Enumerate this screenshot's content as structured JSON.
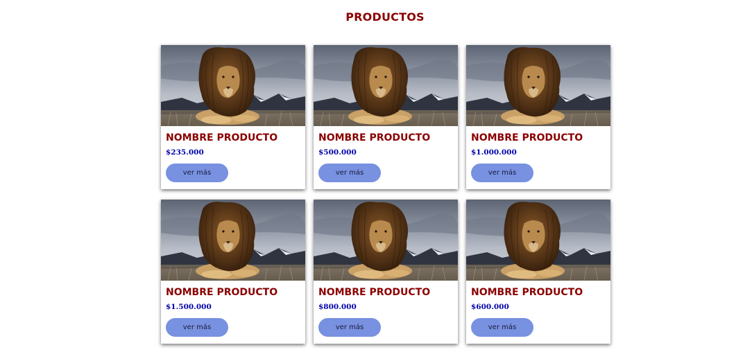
{
  "page": {
    "title": "PRODUCTOS"
  },
  "products": [
    {
      "name": "NOMBRE PRODUCTO",
      "price": "$235.000",
      "button": "ver más"
    },
    {
      "name": "NOMBRE PRODUCTO",
      "price": "$500.000",
      "button": "ver más"
    },
    {
      "name": "NOMBRE PRODUCTO",
      "price": "$1.000.000",
      "button": "ver más"
    },
    {
      "name": "NOMBRE PRODUCTO",
      "price": "$1.500.000",
      "button": "ver más"
    },
    {
      "name": "NOMBRE PRODUCTO",
      "price": "$800.000",
      "button": "ver más"
    },
    {
      "name": "NOMBRE PRODUCTO",
      "price": "$600.000",
      "button": "ver más"
    }
  ],
  "colors": {
    "title": "#8b0000",
    "price": "#0000aa",
    "button": "#7891e0"
  }
}
